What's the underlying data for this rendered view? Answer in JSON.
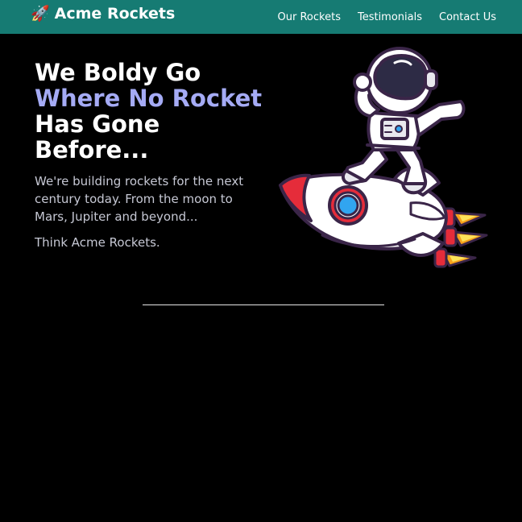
{
  "nav": {
    "brand_icon": "rocket-icon",
    "brand_label": "Acme Rockets",
    "links": [
      {
        "label": "Our Rockets"
      },
      {
        "label": "Testimonials"
      },
      {
        "label": "Contact Us"
      }
    ]
  },
  "hero": {
    "headline_line1": "We Boldy Go",
    "headline_line2": "Where No Rocket",
    "headline_line3": "Has Gone",
    "headline_line4": "Before...",
    "description": "We're building rockets for the next century today. From the moon to Mars, Jupiter and beyond...",
    "tagline": "Think Acme Rockets.",
    "illustration": "astronaut-riding-rocket-illustration"
  },
  "colors": {
    "navbar": "#167b73",
    "background": "#000000",
    "accent": "#a5abf5",
    "body_text": "#c6c8d4"
  }
}
